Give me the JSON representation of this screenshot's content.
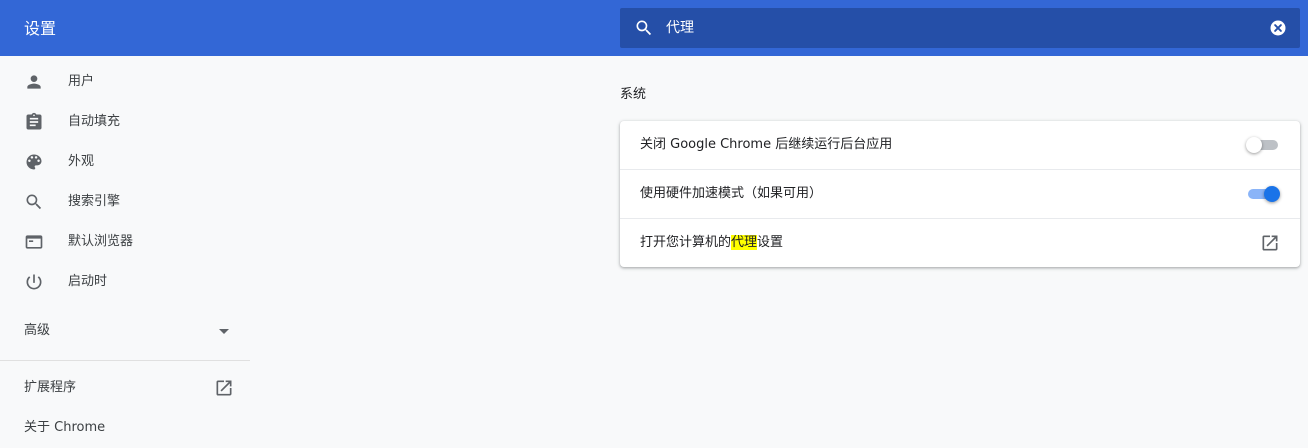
{
  "header": {
    "title": "设置",
    "search": {
      "value": "代理",
      "icon": "search-icon",
      "clear_icon": "clear-icon"
    }
  },
  "sidebar": {
    "items": [
      {
        "label": "用户",
        "icon": "person-icon"
      },
      {
        "label": "自动填充",
        "icon": "clipboard-icon"
      },
      {
        "label": "外观",
        "icon": "palette-icon"
      },
      {
        "label": "搜索引擎",
        "icon": "search-icon"
      },
      {
        "label": "默认浏览器",
        "icon": "browser-icon"
      },
      {
        "label": "启动时",
        "icon": "power-icon"
      }
    ],
    "advanced": {
      "label": "高级",
      "icon": "arrow-drop-down-icon"
    },
    "extensions": {
      "label": "扩展程序",
      "icon": "open-in-new-icon"
    },
    "about": {
      "label": "关于 Chrome"
    }
  },
  "main": {
    "section_title": "系统",
    "rows": [
      {
        "label": "关闭 Google Chrome 后继续运行后台应用",
        "toggle": false
      },
      {
        "label": "使用硬件加速模式（如果可用）",
        "toggle": true
      },
      {
        "label_before": "打开您计算机的",
        "label_highlight": "代理",
        "label_after": "设置",
        "icon": "open-in-new-icon"
      }
    ]
  },
  "colors": {
    "header_bg": "#3367d6",
    "search_bg": "#254fa8",
    "page_bg": "#f8f9fa",
    "toggle_on": "#1a73e8",
    "highlight": "#ffff00"
  }
}
